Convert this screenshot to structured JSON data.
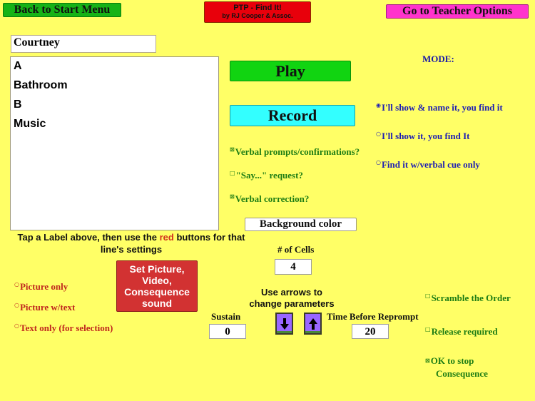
{
  "header": {
    "back_label": "Back to Start Menu",
    "app_title": "PTP - Find It!",
    "app_subtitle": "by RJ Cooper & Assoc.",
    "teacher_label": "Go to Teacher Options"
  },
  "student": {
    "name": "Courtney"
  },
  "labels_list": {
    "items": [
      "A",
      "Bathroom",
      "B",
      "Music"
    ]
  },
  "actions": {
    "play_label": "Play",
    "record_label": "Record",
    "background_color_label": "Background color"
  },
  "mode": {
    "title": "MODE:",
    "options": [
      {
        "label": "I'll show & name it, you find it",
        "selected": true
      },
      {
        "label": "I'll show it, you find It",
        "selected": false
      },
      {
        "label": "Find it w/verbal cue only",
        "selected": false
      }
    ]
  },
  "verbal_options": [
    {
      "label": "Verbal prompts/confirmations?",
      "checked": true
    },
    {
      "label": "\"Say...\" request?",
      "checked": false
    },
    {
      "label": "Verbal correction?",
      "checked": true
    }
  ],
  "instructions": {
    "before": "Tap a Label above, then use the ",
    "highlight": "red",
    "after": " buttons for that line's settings"
  },
  "display_options": [
    {
      "label": "Picture only",
      "selected": false
    },
    {
      "label": "Picture w/text",
      "selected": false
    },
    {
      "label": "Text only (for selection)",
      "selected": false
    }
  ],
  "set_picture_button": {
    "lines": [
      "Set Picture,",
      "Video,",
      "Consequence",
      "sound"
    ]
  },
  "parameters": {
    "cells_label": "# of Cells",
    "cells_value": "4",
    "arrows_hint_line1": "Use arrows to",
    "arrows_hint_line2": "change parameters",
    "sustain_label": "Sustain",
    "sustain_value": "0",
    "reprompt_label": "Time Before Reprompt",
    "reprompt_value": "20"
  },
  "other_options": [
    {
      "label": "Scramble the Order",
      "checked": false
    },
    {
      "label": "Release required",
      "checked": false
    },
    {
      "label": "OK to stop",
      "label2": "Consequence",
      "checked": true
    }
  ],
  "colors": {
    "background": "#ffff66",
    "play": "#11d411",
    "record": "#33ffff",
    "teacher": "#ff33cc",
    "title_box": "#e8000b",
    "set_picture": "#d23232",
    "arrow_buttons": "#9966ff"
  }
}
